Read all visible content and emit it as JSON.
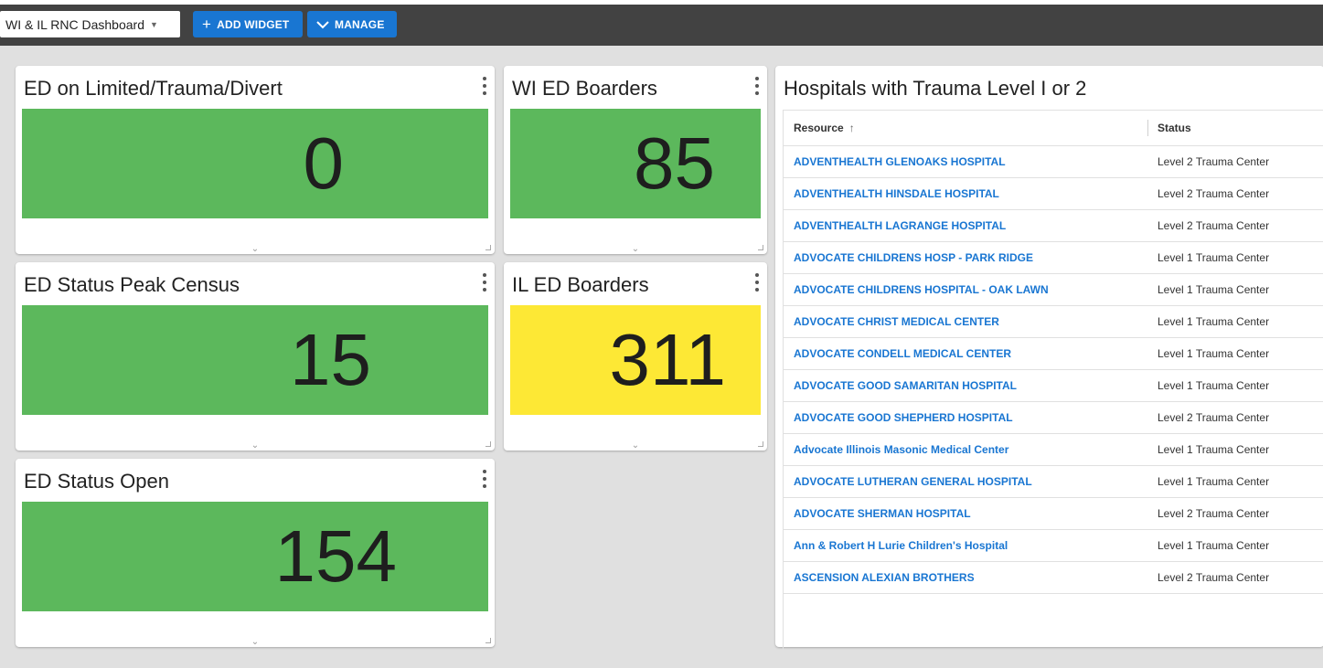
{
  "header": {
    "dashboard_select": "WI & IL RNC Dashboard",
    "add_widget_label": "ADD WIDGET",
    "manage_label": "MANAGE"
  },
  "widgets": [
    {
      "title": "ED on Limited/Trauma/Divert",
      "value": "0",
      "color": "#5cb85c"
    },
    {
      "title": "WI ED Boarders",
      "value": "85",
      "color": "#5cb85c"
    },
    {
      "title": "ED Status Peak Census",
      "value": "15",
      "color": "#5cb85c"
    },
    {
      "title": "IL ED Boarders",
      "value": "311",
      "color": "#fde835"
    },
    {
      "title": "ED Status Open",
      "value": "154",
      "color": "#5cb85c"
    }
  ],
  "table": {
    "title": "Hospitals with Trauma Level I or 2",
    "columns": {
      "resource": "Resource",
      "status": "Status"
    },
    "rows": [
      {
        "resource": "ADVENTHEALTH GLENOAKS HOSPITAL",
        "status": "Level 2 Trauma Center"
      },
      {
        "resource": "ADVENTHEALTH HINSDALE HOSPITAL",
        "status": "Level 2 Trauma Center"
      },
      {
        "resource": "ADVENTHEALTH LAGRANGE HOSPITAL",
        "status": "Level 2 Trauma Center"
      },
      {
        "resource": "ADVOCATE CHILDRENS HOSP - PARK RIDGE",
        "status": "Level 1 Trauma Center"
      },
      {
        "resource": "ADVOCATE CHILDRENS HOSPITAL - OAK LAWN",
        "status": "Level 1 Trauma Center"
      },
      {
        "resource": "ADVOCATE CHRIST MEDICAL CENTER",
        "status": "Level 1 Trauma Center"
      },
      {
        "resource": "ADVOCATE CONDELL MEDICAL CENTER",
        "status": "Level 1 Trauma Center"
      },
      {
        "resource": "ADVOCATE GOOD SAMARITAN HOSPITAL",
        "status": "Level 1 Trauma Center"
      },
      {
        "resource": "ADVOCATE GOOD SHEPHERD HOSPITAL",
        "status": "Level 2 Trauma Center"
      },
      {
        "resource": "Advocate Illinois Masonic Medical Center",
        "status": "Level 1 Trauma Center"
      },
      {
        "resource": "ADVOCATE LUTHERAN GENERAL HOSPITAL",
        "status": "Level 1 Trauma Center"
      },
      {
        "resource": "ADVOCATE SHERMAN HOSPITAL",
        "status": "Level 2 Trauma Center"
      },
      {
        "resource": "Ann & Robert H Lurie Children's Hospital",
        "status": "Level 1 Trauma Center"
      },
      {
        "resource": "ASCENSION ALEXIAN BROTHERS",
        "status": "Level 2 Trauma Center"
      }
    ]
  }
}
